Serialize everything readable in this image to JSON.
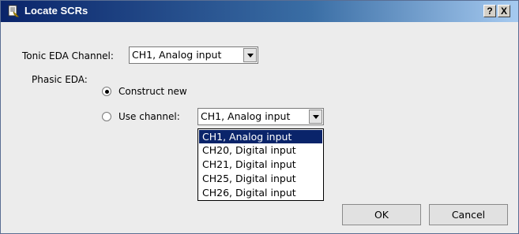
{
  "window": {
    "title": "Locate SCRs",
    "help_label": "?",
    "close_label": "X"
  },
  "tonic": {
    "label": "Tonic EDA Channel:",
    "value": "CH1, Analog input"
  },
  "phasic": {
    "label": "Phasic EDA:",
    "construct_new_label": "Construct new",
    "construct_new_checked": true,
    "use_channel_label": "Use channel:",
    "use_channel_checked": false,
    "use_channel_value": "CH1, Analog input",
    "options": [
      "CH1, Analog input",
      "CH20, Digital input",
      "CH21, Digital input",
      "CH25, Digital input",
      "CH26, Digital input"
    ],
    "highlighted_option": "CH1, Analog input"
  },
  "buttons": {
    "ok": "OK",
    "cancel": "Cancel"
  },
  "colors": {
    "titlebar_start": "#0a246a",
    "titlebar_end": "#a6caf0",
    "selection": "#0a246a",
    "dialog_bg": "#ececec"
  }
}
